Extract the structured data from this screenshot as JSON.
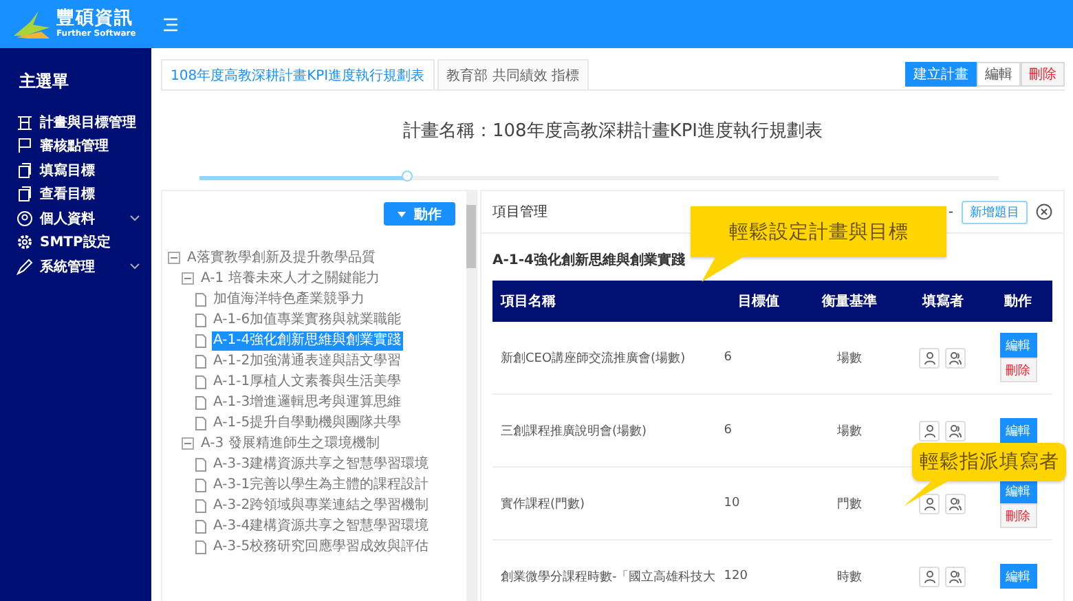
{
  "brand": {
    "name": "豐碩資訊",
    "tagline": "Further Software"
  },
  "sidebar": {
    "title": "主選單",
    "items": [
      {
        "label": "計畫與目標管理",
        "submenu": false
      },
      {
        "label": "審核點管理",
        "submenu": false
      },
      {
        "label": "填寫目標",
        "submenu": false
      },
      {
        "label": "查看目標",
        "submenu": false
      },
      {
        "label": "個人資料",
        "submenu": true
      },
      {
        "label": "SMTP設定",
        "submenu": false
      },
      {
        "label": "系統管理",
        "submenu": true
      }
    ]
  },
  "tabs": [
    {
      "label": "108年度高教深耕計畫KPI進度執行規劃表",
      "selected": true
    },
    {
      "label": "教育部 共同績效 指標",
      "selected": false
    }
  ],
  "toolbar": [
    {
      "label": "建立計畫",
      "kind": "primary"
    },
    {
      "label": "編輯",
      "kind": "default"
    },
    {
      "label": "刪除",
      "kind": "danger"
    }
  ],
  "plan_title": "計畫名稱：108年度高教深耕計畫KPI進度執行規劃表",
  "slider": {
    "level": 0.26
  },
  "action_button": "動作",
  "tree": [
    {
      "label": "A落實教學創新及提升教學品質",
      "expanded": true,
      "selected": false,
      "children": [
        {
          "label": "A-1 培養未來人才之關鍵能力",
          "expanded": true,
          "selected": false,
          "children": [
            {
              "label": "加值海洋特色產業競爭力",
              "selected": false
            },
            {
              "label": "A-1-6加值專業實務與就業職能",
              "selected": false
            },
            {
              "label": "A-1-4強化創新思維與創業實踐",
              "selected": true
            },
            {
              "label": "A-1-2加強溝通表達與語文學習",
              "selected": false
            },
            {
              "label": "A-1-1厚植人文素養與生活美學",
              "selected": false
            },
            {
              "label": "A-1-3增進邏輯思考與運算思維",
              "selected": false
            },
            {
              "label": "A-1-5提升自學動機與團隊共學",
              "selected": false
            }
          ]
        },
        {
          "label": "A-3 發展精進師生之環境機制",
          "expanded": true,
          "selected": false,
          "children": [
            {
              "label": "A-3-3建構資源共享之智慧學習環境",
              "selected": false
            },
            {
              "label": "A-3-1完善以學生為主體的課程設計",
              "selected": false
            },
            {
              "label": "A-3-2跨領域與專業連結之學習機制",
              "selected": false
            },
            {
              "label": "A-3-4建構資源共享之智慧學習環境",
              "selected": false
            },
            {
              "label": "A-3-5校務研究回應學習成效與評估",
              "selected": false
            }
          ]
        }
      ]
    }
  ],
  "panel": {
    "title": "項目管理",
    "collapse": "-",
    "add_button": "新增題目"
  },
  "section_title": "A-1-4強化創新思維與創業實踐",
  "table": {
    "columns": [
      "項目名稱",
      "目標值",
      "衡量基準",
      "填寫者",
      "動作"
    ],
    "rows": [
      {
        "name": "新創CEO講座師交流推廣會(場數)",
        "target": "6",
        "measure": "場數",
        "actions": [
          "編輯",
          "刪除"
        ]
      },
      {
        "name": "三創課程推廣說明會(場數)",
        "target": "6",
        "measure": "場數",
        "actions": [
          "編輯"
        ]
      },
      {
        "name": "實作課程(門數)",
        "target": "10",
        "measure": "門數",
        "actions": [
          "編輯",
          "刪除"
        ]
      },
      {
        "name": "創業微學分課程時數-「國立高雄科技大",
        "target": "120",
        "measure": "時數",
        "actions": [
          "編輯"
        ]
      }
    ]
  },
  "callouts": [
    {
      "text": "輕鬆設定計畫與目標"
    },
    {
      "text": "輕鬆指派填寫者"
    }
  ]
}
